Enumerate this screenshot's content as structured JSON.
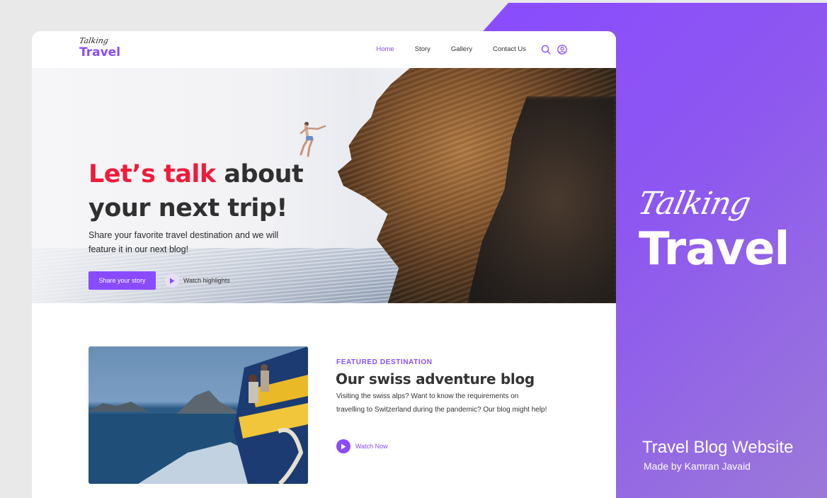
{
  "site": {
    "logo": {
      "script": "Talking",
      "title": "Travel"
    },
    "nav": {
      "items": [
        {
          "label": "Home",
          "active": true
        },
        {
          "label": "Story",
          "active": false
        },
        {
          "label": "Gallery",
          "active": false
        },
        {
          "label": "Contact Us",
          "active": false
        }
      ],
      "icons": [
        "search-icon",
        "user-icon"
      ]
    },
    "hero": {
      "title_accent": "Let’s talk",
      "title_rest": "about your next trip!",
      "description": "Share your favorite travel destination and we will feature it in our next blog!",
      "primary_button": "Share your story",
      "secondary_link": "Watch highlights"
    },
    "featured": {
      "label": "FEATURED DESTINATION",
      "title": "Our swiss adventure blog",
      "description": "Visiting the swiss alps? Want to know the requirements on travelling to Switzerland during the pandemic? Our blog might help!",
      "link": "Watch Now"
    }
  },
  "showcase": {
    "script": "Talking",
    "title": "Travel",
    "footer_title": "Travel Blog Website",
    "footer_sub": "Made by Kamran Javaid"
  },
  "colors": {
    "accent": "#8a4bff",
    "headline_red": "#ee1c3a",
    "text_dark": "#303030"
  }
}
